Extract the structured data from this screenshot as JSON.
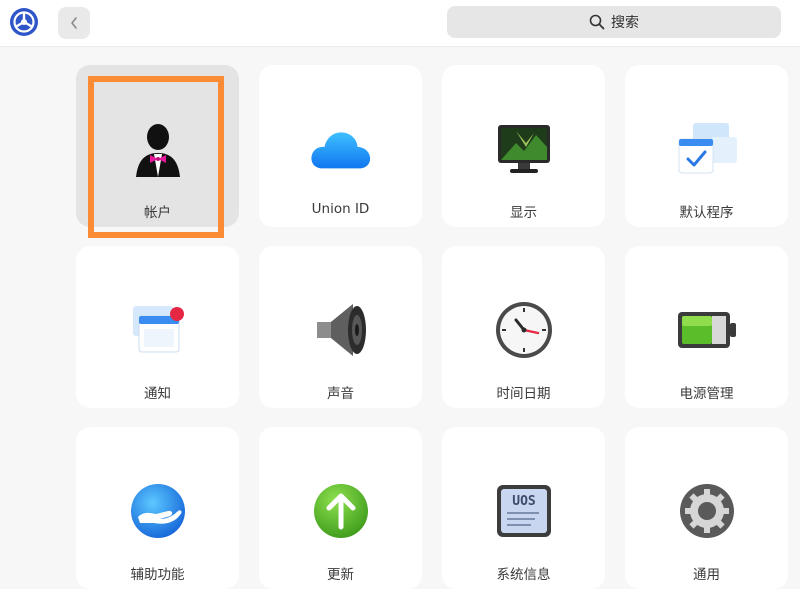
{
  "window": {
    "app_icon": "deepin-settings-logo-icon",
    "back_icon": "chevron-left-icon"
  },
  "search": {
    "placeholder": "搜索",
    "icon": "search-icon"
  },
  "modules": [
    {
      "label": "帐户",
      "icon": "account-user-icon",
      "selected": true
    },
    {
      "label": "Union ID",
      "icon": "cloud-icon"
    },
    {
      "label": "显示",
      "icon": "monitor-icon"
    },
    {
      "label": "默认程序",
      "icon": "default-apps-icon"
    },
    {
      "label": "通知",
      "icon": "notification-icon"
    },
    {
      "label": "声音",
      "icon": "speaker-icon"
    },
    {
      "label": "时间日期",
      "icon": "clock-icon"
    },
    {
      "label": "电源管理",
      "icon": "battery-icon"
    },
    {
      "label": "辅助功能",
      "icon": "accessibility-hand-icon"
    },
    {
      "label": "更新",
      "icon": "update-arrow-icon"
    },
    {
      "label": "系统信息",
      "icon": "system-info-icon",
      "badge_text": "UOS"
    },
    {
      "label": "通用",
      "icon": "gear-icon"
    }
  ],
  "colors": {
    "highlight": "#fb8b34",
    "tile_bg": "#ffffff",
    "selected_tile_bg": "#e4e4e4"
  }
}
